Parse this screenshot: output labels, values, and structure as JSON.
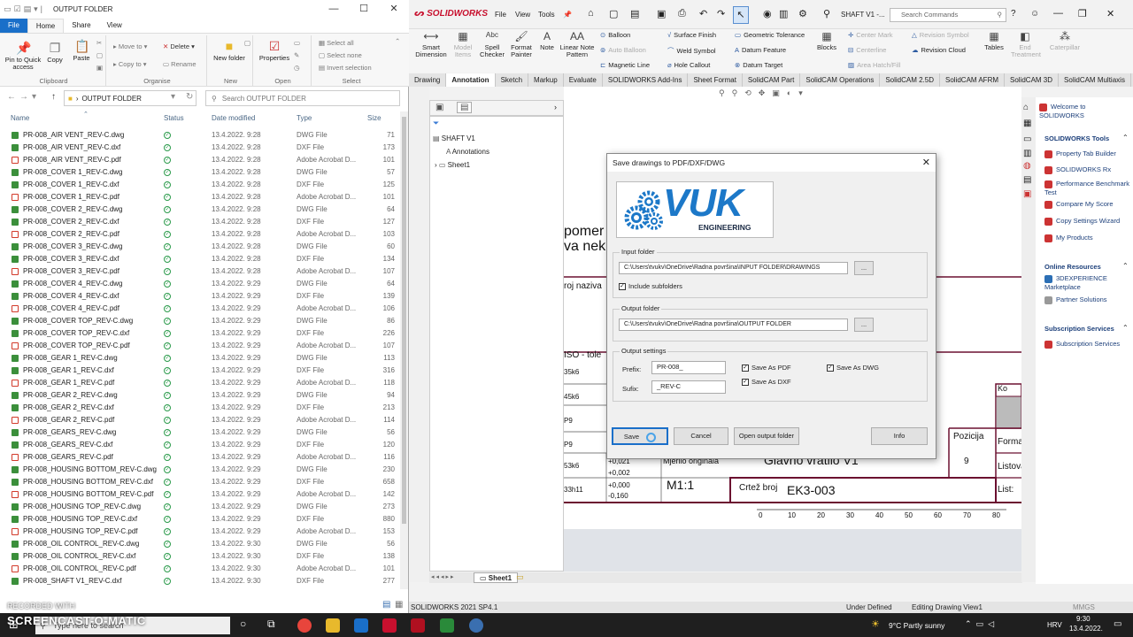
{
  "explorer": {
    "title": "OUTPUT FOLDER",
    "tabs": [
      "File",
      "Home",
      "Share",
      "View"
    ],
    "ribbon": {
      "clipboard": {
        "label": "Clipboard",
        "pin": "Pin to Quick access",
        "copy": "Copy",
        "paste": "Paste"
      },
      "organise": {
        "label": "Organise",
        "move_to": "Move to",
        "copy_to": "Copy to",
        "delete": "Delete",
        "rename": "Rename"
      },
      "new": {
        "label": "New",
        "new_folder": "New folder"
      },
      "open": {
        "label": "Open",
        "properties": "Properties"
      },
      "select": {
        "label": "Select",
        "select_all": "Select all",
        "select_none": "Select none",
        "invert": "Invert selection"
      }
    },
    "address": "OUTPUT FOLDER",
    "search_placeholder": "Search OUTPUT FOLDER",
    "columns": {
      "name": "Name",
      "status": "Status",
      "date": "Date modified",
      "type": "Type",
      "size": "Size"
    },
    "files": [
      {
        "name": "PR-008_AIR VENT_REV-C.dwg",
        "date": "13.4.2022. 9:28",
        "type": "DWG File",
        "size": "71",
        "kind": "dwg"
      },
      {
        "name": "PR-008_AIR VENT_REV-C.dxf",
        "date": "13.4.2022. 9:28",
        "type": "DXF File",
        "size": "173",
        "kind": "dxf"
      },
      {
        "name": "PR-008_AIR VENT_REV-C.pdf",
        "date": "13.4.2022. 9:28",
        "type": "Adobe Acrobat D...",
        "size": "101",
        "kind": "pdf"
      },
      {
        "name": "PR-008_COVER 1_REV-C.dwg",
        "date": "13.4.2022. 9:28",
        "type": "DWG File",
        "size": "57",
        "kind": "dwg"
      },
      {
        "name": "PR-008_COVER 1_REV-C.dxf",
        "date": "13.4.2022. 9:28",
        "type": "DXF File",
        "size": "125",
        "kind": "dxf"
      },
      {
        "name": "PR-008_COVER 1_REV-C.pdf",
        "date": "13.4.2022. 9:28",
        "type": "Adobe Acrobat D...",
        "size": "101",
        "kind": "pdf"
      },
      {
        "name": "PR-008_COVER 2_REV-C.dwg",
        "date": "13.4.2022. 9:28",
        "type": "DWG File",
        "size": "64",
        "kind": "dwg"
      },
      {
        "name": "PR-008_COVER 2_REV-C.dxf",
        "date": "13.4.2022. 9:28",
        "type": "DXF File",
        "size": "127",
        "kind": "dxf"
      },
      {
        "name": "PR-008_COVER 2_REV-C.pdf",
        "date": "13.4.2022. 9:28",
        "type": "Adobe Acrobat D...",
        "size": "103",
        "kind": "pdf"
      },
      {
        "name": "PR-008_COVER 3_REV-C.dwg",
        "date": "13.4.2022. 9:28",
        "type": "DWG File",
        "size": "60",
        "kind": "dwg"
      },
      {
        "name": "PR-008_COVER 3_REV-C.dxf",
        "date": "13.4.2022. 9:28",
        "type": "DXF File",
        "size": "134",
        "kind": "dxf"
      },
      {
        "name": "PR-008_COVER 3_REV-C.pdf",
        "date": "13.4.2022. 9:28",
        "type": "Adobe Acrobat D...",
        "size": "107",
        "kind": "pdf"
      },
      {
        "name": "PR-008_COVER 4_REV-C.dwg",
        "date": "13.4.2022. 9:29",
        "type": "DWG File",
        "size": "64",
        "kind": "dwg"
      },
      {
        "name": "PR-008_COVER 4_REV-C.dxf",
        "date": "13.4.2022. 9:29",
        "type": "DXF File",
        "size": "139",
        "kind": "dxf"
      },
      {
        "name": "PR-008_COVER 4_REV-C.pdf",
        "date": "13.4.2022. 9:29",
        "type": "Adobe Acrobat D...",
        "size": "106",
        "kind": "pdf"
      },
      {
        "name": "PR-008_COVER TOP_REV-C.dwg",
        "date": "13.4.2022. 9:29",
        "type": "DWG File",
        "size": "86",
        "kind": "dwg"
      },
      {
        "name": "PR-008_COVER TOP_REV-C.dxf",
        "date": "13.4.2022. 9:29",
        "type": "DXF File",
        "size": "226",
        "kind": "dxf"
      },
      {
        "name": "PR-008_COVER TOP_REV-C.pdf",
        "date": "13.4.2022. 9:29",
        "type": "Adobe Acrobat D...",
        "size": "107",
        "kind": "pdf"
      },
      {
        "name": "PR-008_GEAR 1_REV-C.dwg",
        "date": "13.4.2022. 9:29",
        "type": "DWG File",
        "size": "113",
        "kind": "dwg"
      },
      {
        "name": "PR-008_GEAR 1_REV-C.dxf",
        "date": "13.4.2022. 9:29",
        "type": "DXF File",
        "size": "316",
        "kind": "dxf"
      },
      {
        "name": "PR-008_GEAR 1_REV-C.pdf",
        "date": "13.4.2022. 9:29",
        "type": "Adobe Acrobat D...",
        "size": "118",
        "kind": "pdf"
      },
      {
        "name": "PR-008_GEAR 2_REV-C.dwg",
        "date": "13.4.2022. 9:29",
        "type": "DWG File",
        "size": "94",
        "kind": "dwg"
      },
      {
        "name": "PR-008_GEAR 2_REV-C.dxf",
        "date": "13.4.2022. 9:29",
        "type": "DXF File",
        "size": "213",
        "kind": "dxf"
      },
      {
        "name": "PR-008_GEAR 2_REV-C.pdf",
        "date": "13.4.2022. 9:29",
        "type": "Adobe Acrobat D...",
        "size": "114",
        "kind": "pdf"
      },
      {
        "name": "PR-008_GEARS_REV-C.dwg",
        "date": "13.4.2022. 9:29",
        "type": "DWG File",
        "size": "56",
        "kind": "dwg"
      },
      {
        "name": "PR-008_GEARS_REV-C.dxf",
        "date": "13.4.2022. 9:29",
        "type": "DXF File",
        "size": "120",
        "kind": "dxf"
      },
      {
        "name": "PR-008_GEARS_REV-C.pdf",
        "date": "13.4.2022. 9:29",
        "type": "Adobe Acrobat D...",
        "size": "116",
        "kind": "pdf"
      },
      {
        "name": "PR-008_HOUSING BOTTOM_REV-C.dwg",
        "date": "13.4.2022. 9:29",
        "type": "DWG File",
        "size": "230",
        "kind": "dwg"
      },
      {
        "name": "PR-008_HOUSING BOTTOM_REV-C.dxf",
        "date": "13.4.2022. 9:29",
        "type": "DXF File",
        "size": "658",
        "kind": "dxf"
      },
      {
        "name": "PR-008_HOUSING BOTTOM_REV-C.pdf",
        "date": "13.4.2022. 9:29",
        "type": "Adobe Acrobat D...",
        "size": "142",
        "kind": "pdf"
      },
      {
        "name": "PR-008_HOUSING TOP_REV-C.dwg",
        "date": "13.4.2022. 9:29",
        "type": "DWG File",
        "size": "273",
        "kind": "dwg"
      },
      {
        "name": "PR-008_HOUSING TOP_REV-C.dxf",
        "date": "13.4.2022. 9:29",
        "type": "DXF File",
        "size": "880",
        "kind": "dxf"
      },
      {
        "name": "PR-008_HOUSING TOP_REV-C.pdf",
        "date": "13.4.2022. 9:29",
        "type": "Adobe Acrobat D...",
        "size": "153",
        "kind": "pdf"
      },
      {
        "name": "PR-008_OIL CONTROL_REV-C.dwg",
        "date": "13.4.2022. 9:30",
        "type": "DWG File",
        "size": "56",
        "kind": "dwg"
      },
      {
        "name": "PR-008_OIL CONTROL_REV-C.dxf",
        "date": "13.4.2022. 9:30",
        "type": "DXF File",
        "size": "138",
        "kind": "dxf"
      },
      {
        "name": "PR-008_OIL CONTROL_REV-C.pdf",
        "date": "13.4.2022. 9:30",
        "type": "Adobe Acrobat D...",
        "size": "101",
        "kind": "pdf"
      },
      {
        "name": "PR-008_SHAFT V1_REV-C.dxf",
        "date": "13.4.2022. 9:30",
        "type": "DXF File",
        "size": "277",
        "kind": "dxf"
      }
    ]
  },
  "solidworks": {
    "brand": "SOLIDWORKS",
    "menu": [
      "File",
      "View",
      "Tools"
    ],
    "doc_title": "SHAFT V1 -...",
    "search_placeholder": "Search Commands",
    "commands": {
      "smart_dimension": "Smart Dimension",
      "model_items": "Model Items",
      "spell_checker": "Spell Checker",
      "format_painter": "Format Painter",
      "note": "Note",
      "linear_note_pattern": "Linear Note Pattern",
      "balloon": "Balloon",
      "auto_balloon": "Auto Balloon",
      "magnetic_line": "Magnetic Line",
      "surface_finish": "Surface Finish",
      "weld_symbol": "Weld Symbol",
      "hole_callout": "Hole Callout",
      "geometric_tolerance": "Geometric Tolerance",
      "datum_feature": "Datum Feature",
      "datum_target": "Datum Target",
      "blocks": "Blocks",
      "center_mark": "Center Mark",
      "centerline": "Centerline",
      "area_hatch": "Area Hatch/Fill",
      "revision_symbol": "Revision Symbol",
      "revision_cloud": "Revision Cloud",
      "tables": "Tables",
      "end_treatment": "End Treatment",
      "caterpillar": "Caterpillar"
    },
    "tabs": [
      "Drawing",
      "Annotation",
      "Sketch",
      "Markup",
      "Evaluate",
      "SOLIDWORKS Add-Ins",
      "Sheet Format",
      "SolidCAM Part",
      "SolidCAM Operations",
      "SolidCAM 2.5D",
      "SolidCAM AFRM",
      "SolidCAM 3D",
      "SolidCAM Multiaxis",
      "Solid..."
    ],
    "active_tab": "Annotation",
    "tree": {
      "root": "SHAFT V1",
      "annotations": "Annotations",
      "sheet": "Sheet1"
    },
    "sheet_tab": "Sheet1",
    "drawing": {
      "text1": "pomer",
      "text2": "va nek",
      "text3": "roj naziva",
      "iso": "ISO - tole",
      "tol": [
        "35k6",
        "45k6",
        "P9",
        "P9",
        "53k6",
        "33h11"
      ],
      "dev": [
        "+0,021",
        "+0,002",
        "+0,000",
        "-0,160"
      ],
      "mjerilo": "Mjerilo originala",
      "scale": "M1:1",
      "naziv": "Glavno vratilo V1",
      "crtez_label": "Crtež broj",
      "crtez_no": "EK3-003",
      "pozicija_label": "Pozicija",
      "pozicija": "9",
      "forma": "Forma",
      "listova": "Listova",
      "list": "List:",
      "ko": "Ko",
      "ruler": [
        "0",
        "10",
        "20",
        "30",
        "40",
        "50",
        "60",
        "70",
        "80"
      ]
    },
    "right_pane": {
      "welcome": "Welcome to SOLIDWORKS",
      "tools_header": "SOLIDWORKS Tools",
      "tools": [
        "Property Tab Builder",
        "SOLIDWORKS Rx",
        "Performance Benchmark Test",
        "Compare My Score",
        "Copy Settings Wizard",
        "My Products"
      ],
      "online_header": "Online Resources",
      "online": [
        "3DEXPERIENCE Marketplace",
        "Partner Solutions"
      ],
      "subscription_header": "Subscription Services",
      "subscription": [
        "Subscription Services"
      ]
    },
    "status": {
      "version": "SOLIDWORKS 2021 SP4.1",
      "state": "Under Defined",
      "editing": "Editing Drawing View1",
      "mmgs": "MMGS"
    }
  },
  "dialog": {
    "title": "Save drawings to PDF/DXF/DWG",
    "logo_main": "VUK",
    "logo_sub": "ENGINEERING",
    "input_label": "Input folder",
    "input_path": "C:\\Users\\tvukv\\OneDrive\\Radna površina\\INPUT FOLDER\\DRAWINGS",
    "include_sub": "Include subfolders",
    "output_label": "Output folder",
    "output_path": "C:\\Users\\tvukv\\OneDrive\\Radna površina\\OUTPUT FOLDER",
    "browse": "...",
    "settings_label": "Output settings",
    "prefix_label": "Prefix:",
    "prefix": "PR-008_",
    "suffix_label": "Sufix:",
    "suffix": "_REV-C",
    "pdf": "Save As PDF",
    "dxf": "Save As DXF",
    "dwg": "Save As DWG",
    "save": "Save",
    "cancel": "Cancel",
    "open_output": "Open output folder",
    "info": "Info"
  },
  "taskbar": {
    "search": "Type here to search",
    "weather": "9°C  Partly sunny",
    "lang": "HRV",
    "time": "9:30",
    "date": "13.4.2022."
  },
  "watermark": {
    "recorded": "RECORDED WITH",
    "brand": "SCREENCAST-O-MATIC"
  },
  "colors": {
    "accent": "#1a6fc9",
    "sw_red": "#c8102e",
    "ok_green": "#2a9a4a",
    "vuk_blue": "#1c78c8",
    "drawing_border": "#6b1030"
  }
}
